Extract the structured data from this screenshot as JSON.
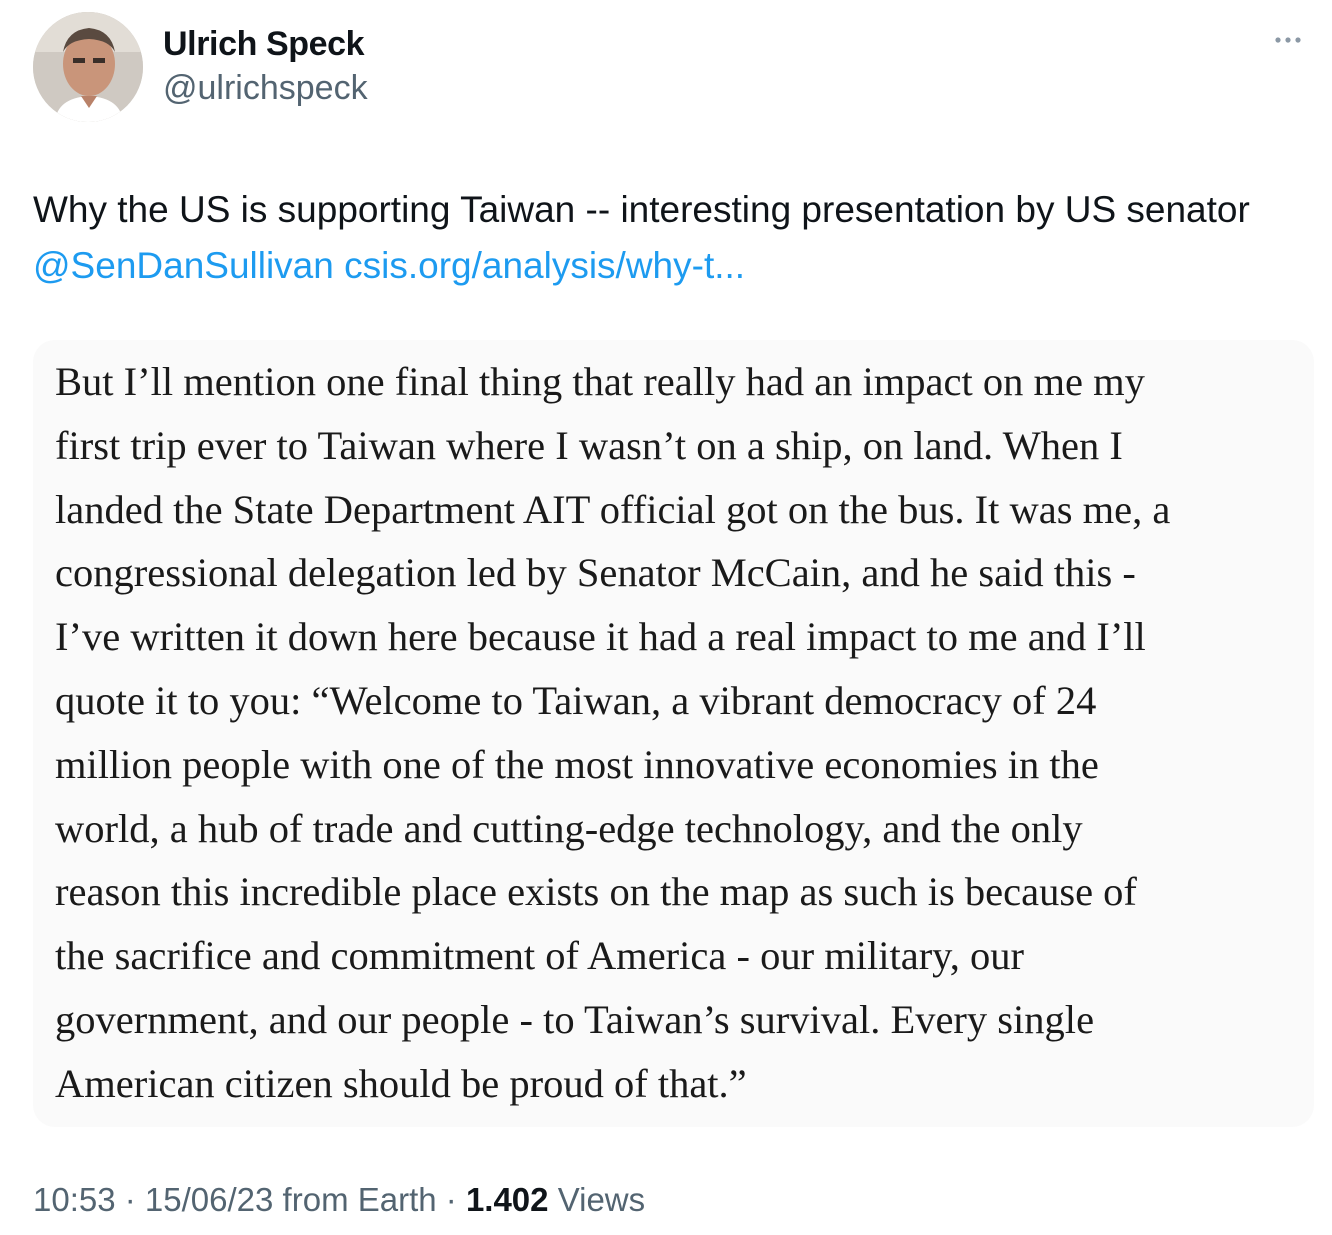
{
  "author": {
    "display_name": "Ulrich Speck",
    "handle": "@ulrichspeck"
  },
  "more_icon": "more-horizontal-icon",
  "tweet": {
    "text_before": "Why the US is supporting Taiwan -- interesting presentation by US senator ",
    "mention": "@SenDanSullivan",
    "link": "csis.org/analysis/why-t..."
  },
  "quote_image": {
    "lines": [
      "But I’ll mention one final thing that really had an impact on me my",
      "first trip ever to Taiwan where I wasn’t on a ship, on land. When I",
      "landed the State Department AIT official got on the bus. It was me, a",
      "congressional delegation led by Senator McCain, and he said this -",
      "I’ve written it down here because it had a real impact to me and I’ll",
      "quote it to you: “Welcome to Taiwan, a vibrant democracy of 24",
      "million people with one of the most innovative economies in the",
      "world, a hub of trade and cutting-edge technology, and the only",
      "reason this incredible place exists on the map as such is because of",
      "the sacrifice and commitment of America - our military, our",
      "government, and our people - to Taiwan’s survival. Every single",
      "American citizen should be proud of that.”"
    ]
  },
  "meta": {
    "time": "10:53",
    "separator": " · ",
    "date": "15/06/23",
    "source": " from Earth",
    "separator2": " · ",
    "views_count": "1.402",
    "views_label": " Views"
  },
  "colors": {
    "link": "#1d9bf0",
    "secondary": "#536471",
    "primary": "#0f1419",
    "card_bg": "#fafafa"
  }
}
